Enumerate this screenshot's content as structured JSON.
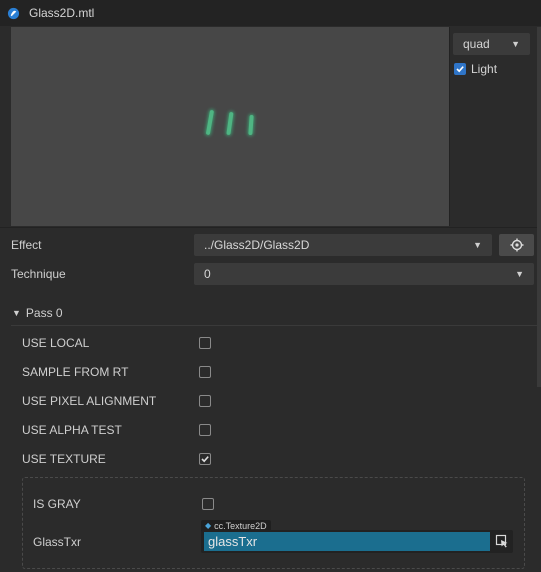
{
  "window": {
    "title": "Glass2D.mtl"
  },
  "preview": {
    "mesh_select": "quad",
    "light_label": "Light",
    "light_checked": true
  },
  "effect": {
    "label": "Effect",
    "value": "../Glass2D/Glass2D"
  },
  "technique": {
    "label": "Technique",
    "value": "0"
  },
  "pass": {
    "header": "Pass 0",
    "options": [
      {
        "label": "USE LOCAL",
        "checked": false
      },
      {
        "label": "SAMPLE FROM RT",
        "checked": false
      },
      {
        "label": "USE PIXEL ALIGNMENT",
        "checked": false
      },
      {
        "label": "USE ALPHA TEST",
        "checked": false
      },
      {
        "label": "USE TEXTURE",
        "checked": true
      }
    ],
    "sub": {
      "is_gray_label": "IS GRAY",
      "is_gray_checked": false,
      "tex_label": "GlassTxr",
      "tex_type": "cc.Texture2D",
      "tex_value": "glassTxr"
    }
  },
  "colors": {
    "accent": "#2f75c8",
    "asset_field": "#1b6e8f",
    "bg": "#2b2b2b"
  }
}
